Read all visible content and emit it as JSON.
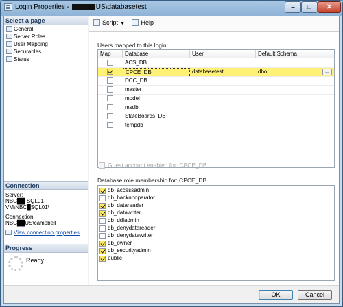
{
  "window": {
    "title_prefix": "Login Properties - ",
    "title_suffix": "US\\databasetest",
    "min_icon": "minimize-icon",
    "max_icon": "maximize-icon",
    "close_icon": "close-icon"
  },
  "left": {
    "select_page_header": "Select a page",
    "pages": [
      {
        "label": "General",
        "icon": "page-icon"
      },
      {
        "label": "Server Roles",
        "icon": "page-icon"
      },
      {
        "label": "User Mapping",
        "icon": "page-icon"
      },
      {
        "label": "Securables",
        "icon": "page-icon"
      },
      {
        "label": "Status",
        "icon": "page-icon"
      }
    ],
    "connection_header": "Connection",
    "server_label": "Server:",
    "server_value": "NBC██-SQL01-VM\\NBC█SQL01\\",
    "connection_label": "Connection:",
    "connection_value": "NBC██US\\campbell",
    "view_link": "View connection properties",
    "progress_header": "Progress",
    "progress_status": "Ready"
  },
  "toolbar": {
    "script_label": "Script",
    "help_label": "Help"
  },
  "mapping": {
    "group_label": "Users mapped to this login:",
    "columns": [
      "Map",
      "Database",
      "User",
      "Default Schema"
    ],
    "rows": [
      {
        "map": false,
        "database": "ACS_DB",
        "user": "",
        "schema": ""
      },
      {
        "map": true,
        "database": "CPCE_DB",
        "user": "databasetest",
        "schema": "dbo"
      },
      {
        "map": false,
        "database": "DCC_DB",
        "user": "",
        "schema": ""
      },
      {
        "map": false,
        "database": "master",
        "user": "",
        "schema": ""
      },
      {
        "map": false,
        "database": "model",
        "user": "",
        "schema": ""
      },
      {
        "map": false,
        "database": "msdb",
        "user": "",
        "schema": ""
      },
      {
        "map": false,
        "database": "StateBoards_DB",
        "user": "",
        "schema": ""
      },
      {
        "map": false,
        "database": "tempdb",
        "user": "",
        "schema": ""
      }
    ],
    "ellipsis": "..."
  },
  "guest_label": "Guest account enabled for: CPCE_DB",
  "roles": {
    "group_label": "Database role membership for: CPCE_DB",
    "items": [
      {
        "label": "db_accessadmin",
        "checked": true
      },
      {
        "label": "db_backupoperator",
        "checked": false
      },
      {
        "label": "db_datareader",
        "checked": true
      },
      {
        "label": "db_datawriter",
        "checked": true
      },
      {
        "label": "db_ddladmin",
        "checked": false
      },
      {
        "label": "db_denydatareader",
        "checked": false
      },
      {
        "label": "db_denydatawriter",
        "checked": false
      },
      {
        "label": "db_owner",
        "checked": true
      },
      {
        "label": "db_securityadmin",
        "checked": true
      },
      {
        "label": "public",
        "checked": true
      }
    ]
  },
  "footer": {
    "ok_label": "OK",
    "cancel_label": "Cancel"
  },
  "colors": {
    "highlight": "#fff176",
    "title_bar": "#8fb3d6",
    "link": "#0b4aa8"
  }
}
